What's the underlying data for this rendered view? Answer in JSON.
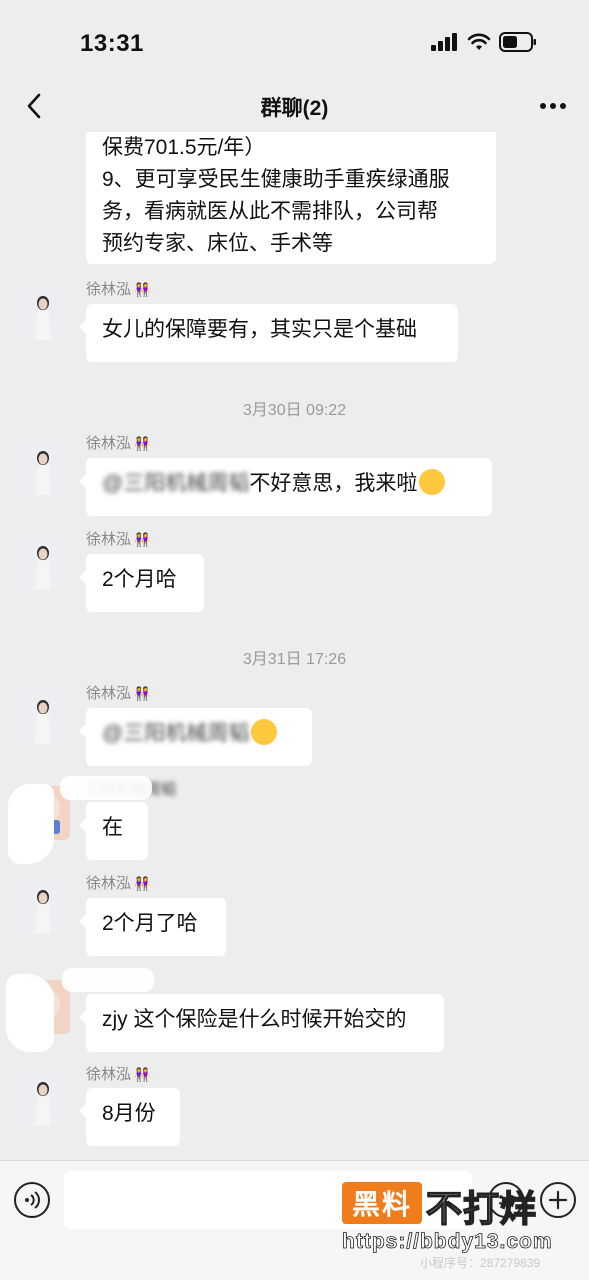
{
  "status_bar": {
    "time": "13:31"
  },
  "nav": {
    "title": "群聊(2)"
  },
  "messages": {
    "m1_line1": "保费701.5元/年）",
    "m1_line2": "9、更可享受民生健康助手重疾绿通服",
    "m1_line3": "务，看病就医从此不需排队，公司帮",
    "m1_line4": "预约专家、床位、手术等",
    "sender_xu": "徐林泓",
    "m2": "女儿的保障要有，其实只是个基础",
    "ts1": "3月30日 09:22",
    "m3_blur": "@三阳机械周韬",
    "m3_text": "不好意思，我来啦",
    "m4": "2个月哈",
    "ts2": "3月31日 17:26",
    "m5_blur": "@三阳机械周韬",
    "sender_zhou": "三阳机械周韬",
    "m6": "在",
    "m7": "2个月了哈",
    "m8": "zjy 这个保险是什么时候开始交的",
    "m9": "8月份"
  },
  "watermark": {
    "box": "黑料",
    "text": "不打烊",
    "url": "https://bbdy13.com",
    "faint": "小程序号：287279839"
  },
  "icons": {
    "back": "chevron-left-icon",
    "more": "more-dots-icon",
    "voice": "voice-icon",
    "emoji": "emoji-icon",
    "plus": "plus-icon"
  }
}
